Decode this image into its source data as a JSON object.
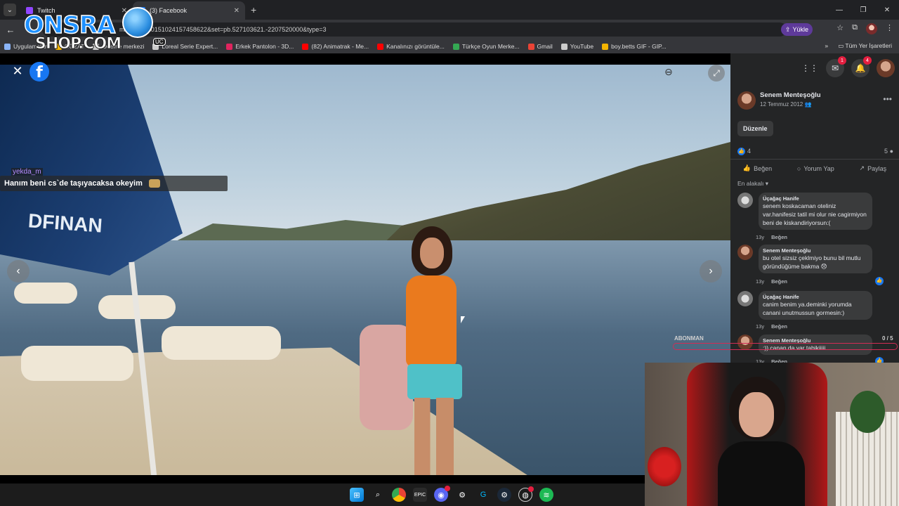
{
  "browser": {
    "tabs": [
      {
        "label": "Twitch",
        "active": false,
        "color": "#9146ff"
      },
      {
        "label": "(3) Facebook",
        "active": true,
        "color": "#1877f2"
      }
    ],
    "url": "m/p...bid=10151024157458622&set=pb.527103621.-2207520000&type=3",
    "upload_label": "Yükle",
    "bookmarks": [
      {
        "label": "Uygulamalar",
        "color": "#8ab4f8"
      },
      {
        "label": "GÖZAT",
        "color": "#f4b400"
      },
      {
        "label": "Ödeme merkezi",
        "color": "#cccccc"
      },
      {
        "label": "Loreal Serie Expert...",
        "color": "#cccccc"
      },
      {
        "label": "Erkek Pantolon - 3D...",
        "color": "#e0245e"
      },
      {
        "label": "(82) Animatrak - Me...",
        "color": "#ff0000"
      },
      {
        "label": "Kanalınızı görüntüle...",
        "color": "#ff0000"
      },
      {
        "label": "Türkçe Oyun Merke...",
        "color": "#34a853"
      },
      {
        "label": "Gmail",
        "color": "#ea4335"
      },
      {
        "label": "YouTube",
        "color": "#cccccc"
      },
      {
        "label": "boy.betts GIF - GIP...",
        "color": "#f4b400"
      }
    ],
    "bookmarks_all": "Tüm Yer İşaretleri"
  },
  "overlay": {
    "logo_line1": "ONSRA",
    "logo_line2": "SHOP.COM",
    "logo_badge": "UC",
    "chat_user": "yekda_m",
    "chat_message": "Hanım beni cs`de taşıyacaksa okeyim",
    "abonman_label": "ABONMAN",
    "abonman_count": "0 / 5",
    "abonman_progress": 0
  },
  "photo": {
    "umbrella_text": "DFINAN"
  },
  "post": {
    "author": "Senem Menteşoğlu",
    "date": "12 Temmuz 2012",
    "edit_label": "Düzenle",
    "reactions": "4",
    "comments_count": "5",
    "actions": {
      "like": "Beğen",
      "comment": "Yorum Yap",
      "share": "Paylaş"
    },
    "sort_label": "En alakalı",
    "comments": [
      {
        "name": "Üçağaç Hanife",
        "text": "senem koskacaman oteliniz var.hanifesiz tatil mi olur nie cagirmiyon beni de kiskandiriyorsun:(",
        "age": "13y",
        "like": "Beğen"
      },
      {
        "name": "Senem Menteşoğlu",
        "text": "bu otel sizsiz çeklmiyo bunu bil mutlu göründüğüme bakma 😞",
        "age": "13y",
        "like": "Beğen"
      },
      {
        "name": "Üçağaç Hanife",
        "text": "canim benim ya.deminki yorumda canani unutmussun gormesin:)",
        "age": "13y",
        "like": "Beğen"
      },
      {
        "name": "Senem Menteşoğlu",
        "text": ":)) canan da var tabikiiiii",
        "age": "13y",
        "like": "Beğen"
      }
    ]
  },
  "fb": {
    "messenger_badge": "1",
    "notif_badge": "4"
  }
}
